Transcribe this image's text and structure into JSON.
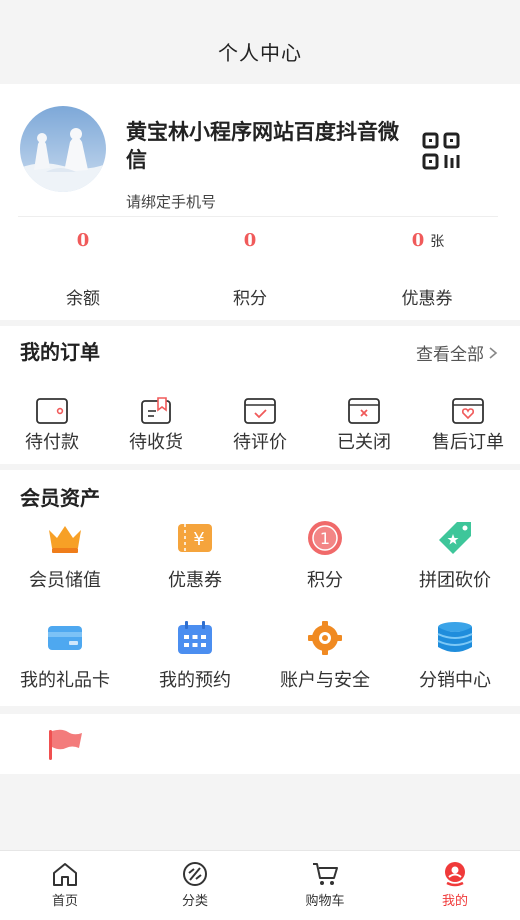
{
  "nav": {
    "title": "个人中心"
  },
  "profile": {
    "name": "黄宝林小程序网站百度抖音微信",
    "bind_phone": "请绑定手机号",
    "qr_icon": "qrcode-icon",
    "stats": [
      {
        "value": "0",
        "unit": "",
        "label": "余额"
      },
      {
        "value": "0",
        "unit": "",
        "label": "积分"
      },
      {
        "value": "0",
        "unit": "张",
        "label": "优惠券"
      }
    ]
  },
  "orders": {
    "title": "我的订单",
    "view_all": "查看全部",
    "items": [
      {
        "label": "待付款",
        "icon": "wallet-icon"
      },
      {
        "label": "待收货",
        "icon": "receipt-icon"
      },
      {
        "label": "待评价",
        "icon": "check-box-icon"
      },
      {
        "label": "已关闭",
        "icon": "close-box-icon"
      },
      {
        "label": "售后订单",
        "icon": "heart-box-icon"
      }
    ]
  },
  "assets": {
    "title": "会员资产",
    "items": [
      {
        "label": "会员储值",
        "icon": "crown-icon"
      },
      {
        "label": "优惠券",
        "icon": "coupon-icon"
      },
      {
        "label": "积分",
        "icon": "medal-icon"
      },
      {
        "label": "拼团砍价",
        "icon": "tag-icon"
      },
      {
        "label": "我的礼品卡",
        "icon": "gift-card-icon"
      },
      {
        "label": "我的预约",
        "icon": "calendar-icon"
      },
      {
        "label": "账户与安全",
        "icon": "settings-icon"
      },
      {
        "label": "分销中心",
        "icon": "database-icon"
      }
    ]
  },
  "extra": {
    "icon": "flag-icon"
  },
  "tabbar": {
    "items": [
      {
        "label": "首页",
        "icon": "home-icon"
      },
      {
        "label": "分类",
        "icon": "category-icon"
      },
      {
        "label": "购物车",
        "icon": "cart-icon"
      },
      {
        "label": "我的",
        "icon": "user-icon"
      }
    ],
    "active_color": "#f03a3a"
  },
  "colors": {
    "accent": "#f05a5a",
    "background": "#f4f4f4"
  }
}
